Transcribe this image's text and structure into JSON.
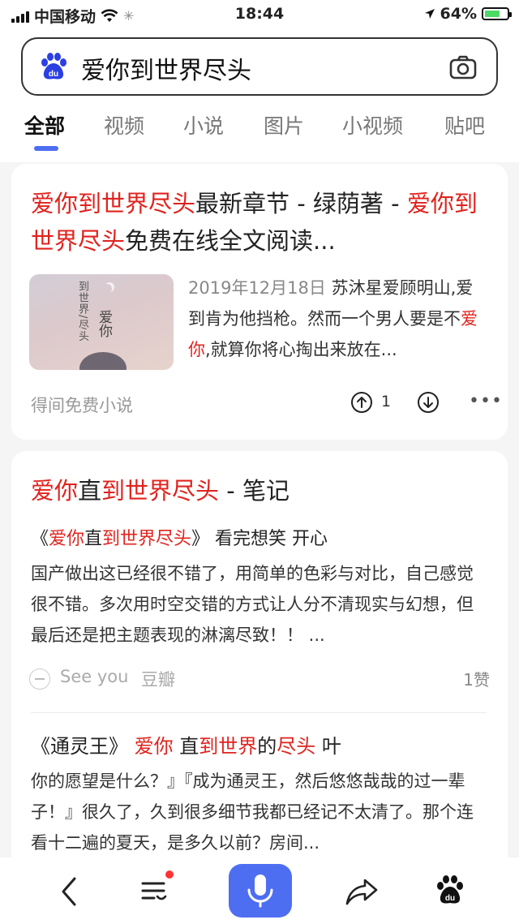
{
  "statusbar": {
    "carrier": "中国移动",
    "time": "18:44",
    "battery": "64%",
    "battery_level": 0.64
  },
  "search": {
    "query": "爱你到世界尽头"
  },
  "tabs": [
    "全部",
    "视频",
    "小说",
    "图片",
    "小视频",
    "贴吧"
  ],
  "active_tab": 0,
  "result1": {
    "title_parts": [
      {
        "text": "爱你到世界尽头",
        "hl": true
      },
      {
        "text": "最新章节 - 绿荫著 - ",
        "hl": false
      },
      {
        "text": "爱你到世界尽头",
        "hl": true
      },
      {
        "text": "免费在线全文阅读...",
        "hl": false
      }
    ],
    "thumb_text_1": "到世界/尽头",
    "thumb_text_2": "爱你",
    "date": "2019年12月18日",
    "snippet_parts": [
      {
        "text": "  苏沐星爱顾明山,爱到肯为他挡枪。然而一个男人要是不",
        "hl": false
      },
      {
        "text": "爱你",
        "hl": true
      },
      {
        "text": ",就算你将心掏出来放在...",
        "hl": false
      }
    ],
    "source": "得间免费小说",
    "up_count": "1"
  },
  "result2": {
    "title_parts": [
      {
        "text": "爱你",
        "hl": true
      },
      {
        "text": "直",
        "hl": false
      },
      {
        "text": "到世界尽头",
        "hl": true
      },
      {
        "text": " - 笔记",
        "hl": false
      }
    ],
    "sub_parts": [
      {
        "text": "《",
        "hl": false
      },
      {
        "text": "爱你",
        "hl": true
      },
      {
        "text": "直",
        "hl": false
      },
      {
        "text": "到世界尽头",
        "hl": true
      },
      {
        "text": "》 看完想笑 开心",
        "hl": false
      }
    ],
    "body": "国产做出这已经很不错了，用简单的色彩与对比，自己感觉很不错。多次用时空交错的方式让人分不清现实与幻想，但最后还是把主题表现的淋漓尽致！！ ...",
    "author": "See you",
    "site": "豆瓣",
    "likes": "1赞"
  },
  "result3": {
    "title_parts": [
      {
        "text": "《通灵王》 ",
        "hl": false
      },
      {
        "text": "爱你",
        "hl": true
      },
      {
        "text": " 直",
        "hl": false
      },
      {
        "text": "到世界",
        "hl": true
      },
      {
        "text": "的",
        "hl": false
      },
      {
        "text": "尽头",
        "hl": true
      },
      {
        "text": " 叶",
        "hl": false
      }
    ],
    "body": "你的愿望是什么？』『成为通灵王，然后悠悠哉哉的过一辈子！』很久了，久到很多细节我都已经记不太清了。那个连看十二遍的夏天，是多久以前？房间..."
  },
  "colors": {
    "accent": "#4e6ef2",
    "highlight": "#e0231e",
    "notification_dot": "#ff3333"
  },
  "icons": [
    "baidu-paw-icon",
    "camera-icon",
    "thumbs-up-icon",
    "thumbs-down-icon",
    "more-icon",
    "back-icon",
    "menu-icon",
    "mic-icon",
    "share-icon",
    "baidu-home-icon"
  ]
}
